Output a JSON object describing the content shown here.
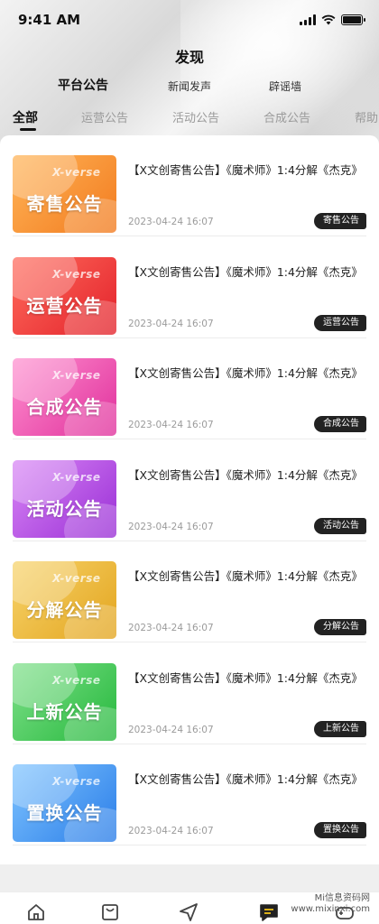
{
  "status_bar": {
    "time": "9:41 AM"
  },
  "header": {
    "title": "发现",
    "sub_tabs": [
      {
        "label": "平台公告",
        "active": true
      },
      {
        "label": "新闻发声",
        "active": false
      },
      {
        "label": "辟谣墙",
        "active": false
      }
    ],
    "category_tabs": [
      {
        "label": "全部",
        "active": true
      },
      {
        "label": "运营公告",
        "active": false
      },
      {
        "label": "活动公告",
        "active": false
      },
      {
        "label": "合成公告",
        "active": false
      },
      {
        "label": "帮助",
        "active": false
      }
    ]
  },
  "announcements": [
    {
      "thumb_label": "寄售公告",
      "brand": "X-verse",
      "title": "【X文创寄售公告】《魔术师》1:4分解《杰克》",
      "date": "2023-04-24 16:07",
      "badge": "寄售公告",
      "color_from": "#ffb457",
      "color_to": "#f27b1f"
    },
    {
      "thumb_label": "运营公告",
      "brand": "X-verse",
      "title": "【X文创寄售公告】《魔术师》1:4分解《杰克》",
      "date": "2023-04-24 16:07",
      "badge": "运营公告",
      "color_from": "#ff6b5c",
      "color_to": "#e3222b"
    },
    {
      "thumb_label": "合成公告",
      "brand": "X-verse",
      "title": "【X文创寄售公告】《魔术师》1:4分解《杰克》",
      "date": "2023-04-24 16:07",
      "badge": "合成公告",
      "color_from": "#ff8fcf",
      "color_to": "#e0309c"
    },
    {
      "thumb_label": "活动公告",
      "brand": "X-verse",
      "title": "【X文创寄售公告】《魔术师》1:4分解《杰克》",
      "date": "2023-04-24 16:07",
      "badge": "活动公告",
      "color_from": "#d885f5",
      "color_to": "#9a2fd6"
    },
    {
      "thumb_label": "分解公告",
      "brand": "X-verse",
      "title": "【X文创寄售公告】《魔术师》1:4分解《杰克》",
      "date": "2023-04-24 16:07",
      "badge": "分解公告",
      "color_from": "#f7d36a",
      "color_to": "#e3a51f"
    },
    {
      "thumb_label": "上新公告",
      "brand": "X-verse",
      "title": "【X文创寄售公告】《魔术师》1:4分解《杰克》",
      "date": "2023-04-24 16:07",
      "badge": "上新公告",
      "color_from": "#7fe08a",
      "color_to": "#25b83c"
    },
    {
      "thumb_label": "置换公告",
      "brand": "X-verse",
      "title": "【X文创寄售公告】《魔术师》1:4分解《杰克》",
      "date": "2023-04-24 16:07",
      "badge": "置换公告",
      "color_from": "#7fc4ff",
      "color_to": "#2a7de8"
    }
  ],
  "bottom_nav": [
    {
      "icon": "home-icon"
    },
    {
      "icon": "bag-icon"
    },
    {
      "icon": "send-icon"
    },
    {
      "icon": "message-icon"
    },
    {
      "icon": "game-icon"
    }
  ],
  "watermark": {
    "line1": "Mi信息资码网",
    "line2": "www.mixinxi.com"
  }
}
